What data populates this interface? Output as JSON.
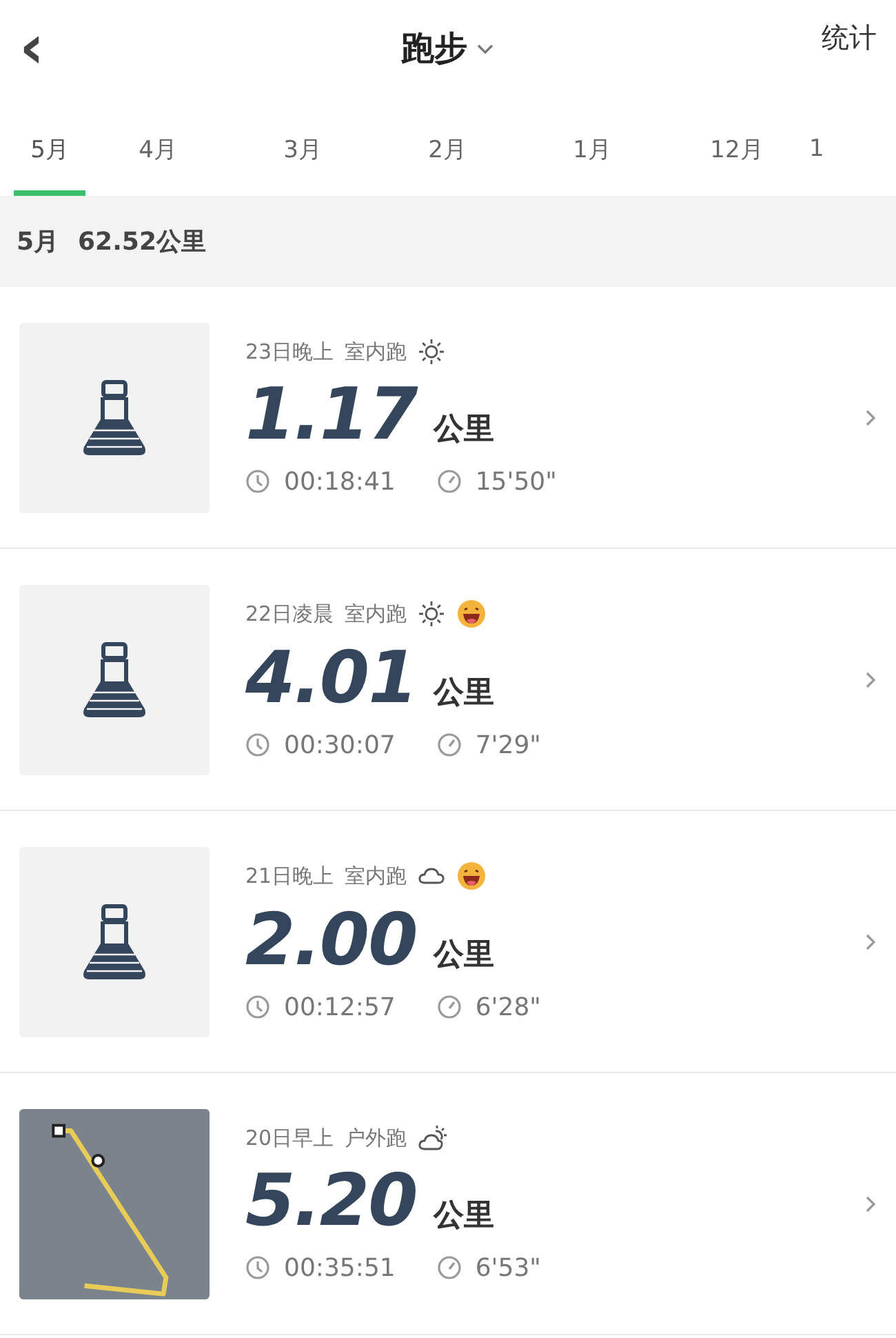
{
  "header": {
    "back_icon": "‹",
    "title": "跑步",
    "action": "统计"
  },
  "tabs": [
    {
      "label": "5月",
      "selected": true
    },
    {
      "label": "4月",
      "selected": false
    },
    {
      "label": "3月",
      "selected": false
    },
    {
      "label": "2月",
      "selected": false
    },
    {
      "label": "1月",
      "selected": false
    },
    {
      "label": "12月",
      "selected": false
    },
    {
      "label": "1",
      "selected": false
    }
  ],
  "summary": {
    "month": "5月",
    "total": "62.52公里"
  },
  "records": [
    {
      "thumbnail": {
        "kind": "treadmill"
      },
      "date": "23日晚上",
      "type": "室内跑",
      "weather": {
        "kind": "sun"
      },
      "mood": false,
      "distance": "1.17",
      "unit": "公里",
      "duration": "00:18:41",
      "pace": "15'50\""
    },
    {
      "thumbnail": {
        "kind": "treadmill"
      },
      "date": "22日凌晨",
      "type": "室内跑",
      "weather": {
        "kind": "sun"
      },
      "mood": true,
      "distance": "4.01",
      "unit": "公里",
      "duration": "00:30:07",
      "pace": "7'29\""
    },
    {
      "thumbnail": {
        "kind": "treadmill"
      },
      "date": "21日晚上",
      "type": "室内跑",
      "weather": {
        "kind": "cloud"
      },
      "mood": true,
      "distance": "2.00",
      "unit": "公里",
      "duration": "00:12:57",
      "pace": "6'28\""
    },
    {
      "thumbnail": {
        "kind": "route"
      },
      "date": "20日早上",
      "type": "户外跑",
      "weather": {
        "kind": "partly-cloudy"
      },
      "mood": false,
      "distance": "5.20",
      "unit": "公里",
      "duration": "00:35:51",
      "pace": "6'53\""
    }
  ]
}
